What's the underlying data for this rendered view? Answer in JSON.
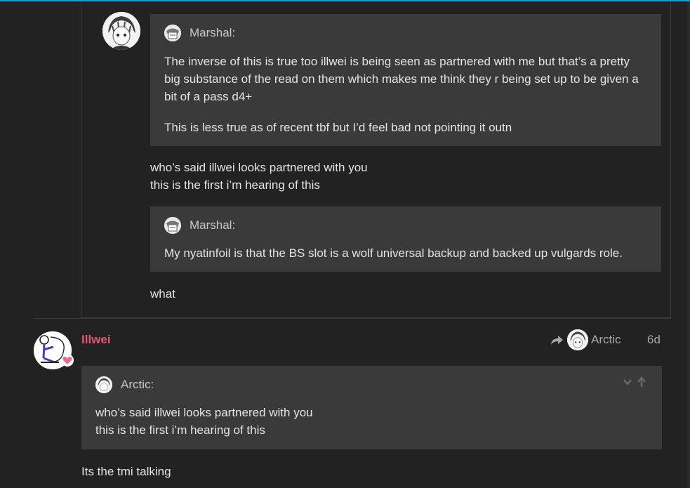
{
  "nested_post": {
    "quote1": {
      "author": "Marshal:",
      "paragraphs": [
        "The inverse of this is true too illwei is being seen as partnered with me but that’s a pretty big substance of the read on them which makes me think they r being set up to be given a bit of a pass d4+",
        "This is less true as of recent tbf but I’d feel bad not pointing it outn"
      ]
    },
    "reply1": [
      "who’s said illwei looks partnered with you",
      "this is the first i’m hearing of this"
    ],
    "quote2": {
      "author": "Marshal:",
      "text": "My nyatinfoil is that the BS slot is a wolf universal backup and backed up vulgards role."
    },
    "reply2": "what"
  },
  "post": {
    "username": "Illwei",
    "reply_to": "Arctic",
    "date": "6d",
    "quote": {
      "author": "Arctic:",
      "lines": [
        "who’s said illwei looks partnered with you",
        "this is the first i’m hearing of this"
      ]
    },
    "body": "Its the tmi talking"
  },
  "colors": {
    "username": "#e45771",
    "accent_bar": "#1a9ed8",
    "quote_bg": "#3a3a3a",
    "page_bg": "#222222"
  },
  "icons": [
    "reply-arrow-icon",
    "chevron-down-icon",
    "arrow-up-icon",
    "heart-badge-icon"
  ]
}
